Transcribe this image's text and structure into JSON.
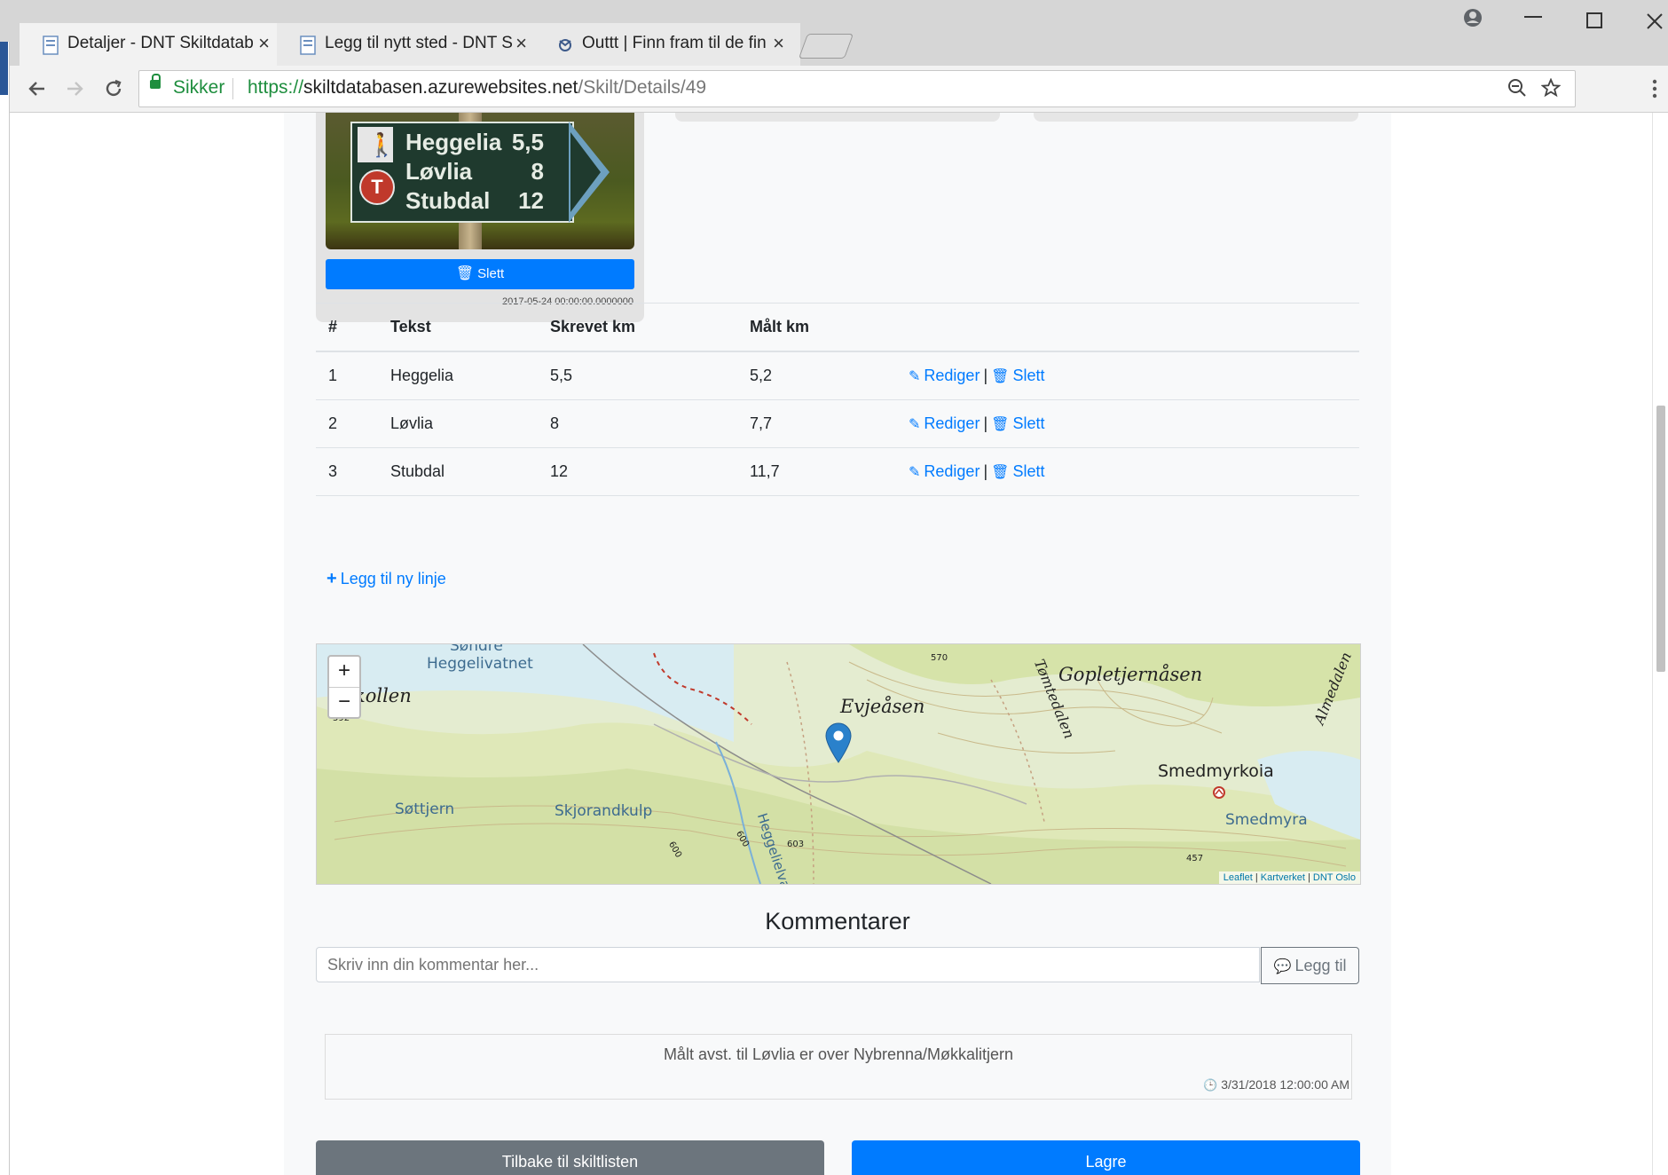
{
  "browser": {
    "tabs": [
      {
        "title": "Detaljer - DNT Skiltdatab",
        "active": true
      },
      {
        "title": "Legg til nytt sted - DNT S",
        "active": false
      },
      {
        "title": "Outtt | Finn fram til de fin",
        "active": false
      }
    ],
    "tab_close": "×",
    "secure_label": "Sikker",
    "url_scheme": "https://",
    "url_host": "skiltdatabasen.azurewebsites.net",
    "url_path": "/Skilt/Details/49"
  },
  "image_card": {
    "sign_rows": [
      {
        "place": "Heggelia",
        "km": "5,5"
      },
      {
        "place": "Løvlia",
        "km": "8"
      },
      {
        "place": "Stubdal",
        "km": "12"
      }
    ],
    "delete_label": "Slett",
    "date": "2017-05-24 00:00:00.0000000"
  },
  "table": {
    "headers": [
      "#",
      "Tekst",
      "Skrevet km",
      "Målt km",
      ""
    ],
    "rows": [
      {
        "n": "1",
        "text": "Heggelia",
        "written": "5,5",
        "measured": "5,2"
      },
      {
        "n": "2",
        "text": "Løvlia",
        "written": "8",
        "measured": "7,7"
      },
      {
        "n": "3",
        "text": "Stubdal",
        "written": "12",
        "measured": "11,7"
      }
    ],
    "edit_label": "Rediger",
    "delete_label": "Slett",
    "add_line_label": "Legg til ny linje"
  },
  "map": {
    "zoom_in": "+",
    "zoom_out": "−",
    "labels": [
      "Søndre",
      "Heggelivatnet",
      "kollen",
      "Evjeåsen",
      "Gopletjernåsen",
      "Tømtedalen",
      "Almedalen",
      "Smedmyrkoia",
      "Smedmyra",
      "Søttjern",
      "Skjorandkulp",
      "Heggelielva"
    ],
    "elevations": [
      "570",
      "592",
      "603",
      "600",
      "600",
      "457"
    ],
    "attribution": [
      "Leaflet",
      "Kartverket",
      "DNT Oslo"
    ]
  },
  "comments": {
    "title": "Kommentarer",
    "placeholder": "Skriv inn din kommentar her...",
    "add_label": "Legg til",
    "items": [
      {
        "text": "Målt avst. til Løvlia er over Nybrenna/Møkkalitjern",
        "date": "3/31/2018 12:00:00 AM"
      }
    ]
  },
  "actions": {
    "back_label": "Tilbake til skiltlisten",
    "save_label": "Lagre"
  }
}
